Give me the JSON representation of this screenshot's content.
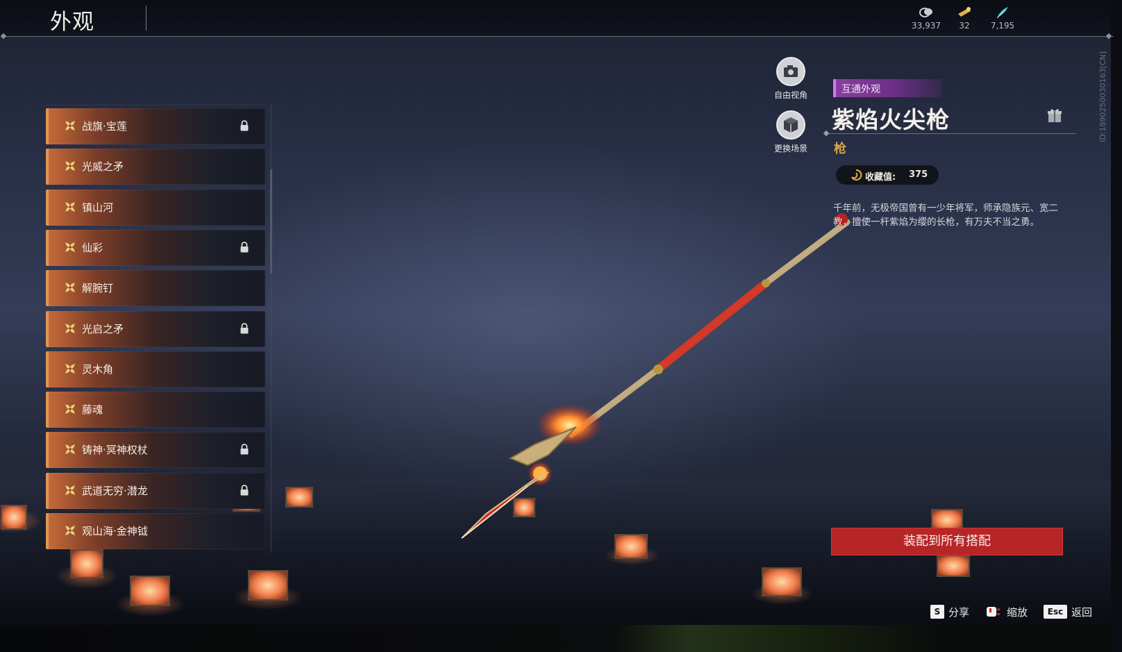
{
  "header": {
    "title": "外观",
    "currencies": [
      {
        "icon": "silver-coin-icon",
        "value": "33,937"
      },
      {
        "icon": "gold-ticket-icon",
        "value": "32"
      },
      {
        "icon": "jade-feather-icon",
        "value": "7,195"
      }
    ]
  },
  "list": {
    "items": [
      {
        "label": "战旗·宝莲",
        "locked": true
      },
      {
        "label": "光威之矛",
        "locked": false
      },
      {
        "label": "镇山河",
        "locked": false
      },
      {
        "label": "仙彩",
        "locked": true
      },
      {
        "label": "解腕钉",
        "locked": false
      },
      {
        "label": "光启之矛",
        "locked": true
      },
      {
        "label": "灵木角",
        "locked": false
      },
      {
        "label": "藤魂",
        "locked": false
      },
      {
        "label": "铸神·冥神权杖",
        "locked": true
      },
      {
        "label": "武道无穷·潜龙",
        "locked": true
      },
      {
        "label": "观山海·金神钺",
        "locked": false
      }
    ]
  },
  "camera": {
    "free_view_label": "自由视角",
    "change_scene_label": "更换场景"
  },
  "detail": {
    "tag": "互通外观",
    "name": "紫焰火尖枪",
    "type": "枪",
    "collect_label": "收藏值:",
    "collect_value": "375",
    "description": "千年前，无极帝国曾有一少年将军，师承隐族元、宽二教，擅使一杆紫焰为缨的长枪，有万夫不当之勇。",
    "id_text": "ID:1890250030163[CN]"
  },
  "actions": {
    "equip_all_label": "装配到所有搭配",
    "hints": [
      {
        "key": "S",
        "label": "分享"
      },
      {
        "key": "",
        "label": "缩放"
      },
      {
        "key": "Esc",
        "label": "返回"
      }
    ]
  },
  "colors": {
    "accent_orange": "#e09552",
    "tag_purple": "#8a3fa0",
    "type_gold": "#d7a548",
    "equip_red": "#b62626"
  }
}
